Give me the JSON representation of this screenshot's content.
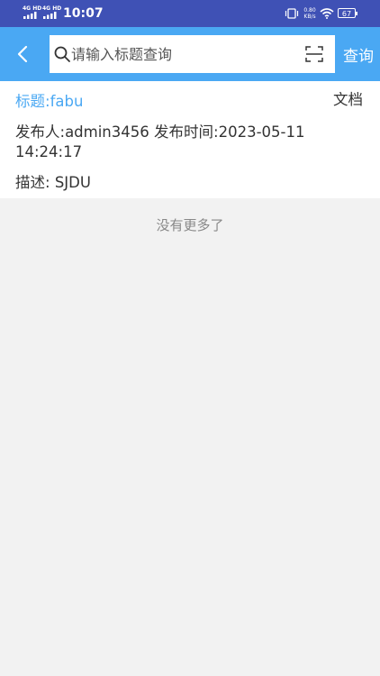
{
  "status_bar": {
    "signal_1": "4G HD",
    "signal_2": "4G HD",
    "time": "10:07",
    "net_speed_value": "0.80",
    "net_speed_unit": "KB/s",
    "battery": "67",
    "colors": {
      "background": "#3f51b5"
    }
  },
  "header": {
    "back_icon": "chevron-left-icon",
    "search_placeholder": "请输入标题查询",
    "search_value": "",
    "search_icon": "search-icon",
    "scan_icon": "scan-icon",
    "query_label": "查询",
    "colors": {
      "background": "#4aa8f3"
    }
  },
  "results": [
    {
      "title_prefix": "标题:",
      "title": "fabu",
      "type": "文档",
      "publisher_label": "发布人:",
      "publisher": "admin3456",
      "time_label": "发布时间:",
      "time": "2023-05-11 14:24:17",
      "desc_label": "描述:",
      "desc": "SJDU"
    }
  ],
  "footer": {
    "no_more": "没有更多了"
  }
}
